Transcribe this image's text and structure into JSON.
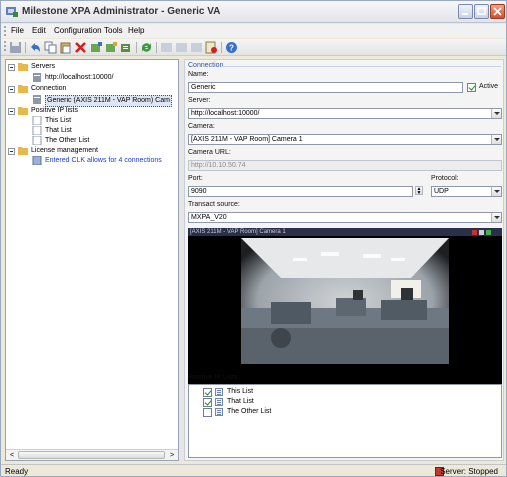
{
  "window": {
    "title": "Milestone XPA Administrator - Generic VA"
  },
  "menu": [
    "File",
    "Edit",
    "Configuration",
    "Tools",
    "Help"
  ],
  "toolbar": {
    "icons": [
      "save-icon",
      "undo-icon",
      "copy-icon",
      "paste-icon",
      "delete-icon",
      "add-server-icon",
      "add-connection-icon",
      "add-list-icon",
      "refresh-icon",
      "start-icon",
      "stop-icon",
      "disabled-icon",
      "license-icon",
      "help-icon"
    ]
  },
  "tree": {
    "servers": {
      "label": "Servers",
      "child": "http://localhost:10000/"
    },
    "connection": {
      "label": "Connection",
      "child": "Generic (AXIS 211M - VAP Room) Cam"
    },
    "positive_ip_lists": {
      "label": "Positive IP lists",
      "children": [
        "This List",
        "That List",
        "The Other List"
      ]
    },
    "license": {
      "label": "License management",
      "child": "Entered CLK allows for 4 connections"
    }
  },
  "connection": {
    "section_title": "Connection",
    "name_label": "Name:",
    "name_value": "Generic",
    "active_label": "Active",
    "active_checked": true,
    "server_label": "Server:",
    "server_value": "http://localhost:10000/",
    "camera_label": "Camera:",
    "camera_value": "[AXIS 211M - VAP Room] Camera 1",
    "camera_url_label": "Camera URL:",
    "camera_url_value": "http://10.10.50.74",
    "port_label": "Port:",
    "port_value": "9090",
    "protocol_label": "Protocol:",
    "protocol_value": "UDP",
    "transact_label": "Transact source:",
    "transact_value": "MXPA_V20",
    "video_title": "[AXIS 211M - VAP Room] Camera 1",
    "ip_lists_label": "Positive IP Lists:",
    "ip_lists": [
      {
        "label": "This List",
        "checked": true
      },
      {
        "label": "That List",
        "checked": true
      },
      {
        "label": "The Other List",
        "checked": false
      }
    ]
  },
  "status": {
    "left": "Ready",
    "right": "Server: Stopped"
  },
  "colors": {
    "accent": "#2a55a8",
    "link": "#1a3fd0",
    "server_stopped": "#c43a2a"
  }
}
